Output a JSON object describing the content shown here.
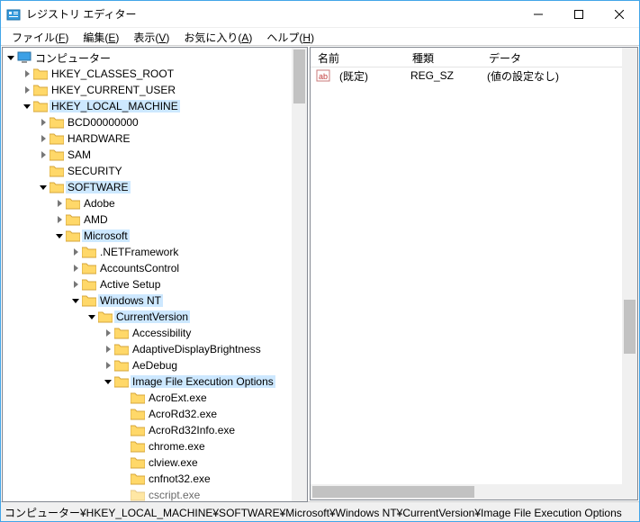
{
  "window": {
    "title": "レジストリ エディター"
  },
  "menu": {
    "file": "ファイル(F)",
    "edit": "編集(E)",
    "view": "表示(V)",
    "favorites": "お気に入り(A)",
    "help": "ヘルプ(H)"
  },
  "tree": {
    "root": "コンピューター",
    "hcr": "HKEY_CLASSES_ROOT",
    "hcu": "HKEY_CURRENT_USER",
    "hlm": "HKEY_LOCAL_MACHINE",
    "bcd": "BCD00000000",
    "hardware": "HARDWARE",
    "sam": "SAM",
    "security": "SECURITY",
    "software": "SOFTWARE",
    "adobe": "Adobe",
    "amd": "AMD",
    "microsoft": "Microsoft",
    "netfw": ".NETFramework",
    "accounts": "AccountsControl",
    "active": "Active Setup",
    "winnt": "Windows NT",
    "curver": "CurrentVersion",
    "access": "Accessibility",
    "adaptive": "AdaptiveDisplayBrightness",
    "aedebug": "AeDebug",
    "ifeo": "Image File Execution Options",
    "acroext": "AcroExt.exe",
    "acrord32": "AcroRd32.exe",
    "acrord32info": "AcroRd32Info.exe",
    "chrome": "chrome.exe",
    "clview": "clview.exe",
    "cnfnot32": "cnfnot32.exe",
    "cscript": "cscript.exe"
  },
  "list": {
    "col_name": "名前",
    "col_type": "種類",
    "col_data": "データ",
    "row0": {
      "name": "(既定)",
      "type": "REG_SZ",
      "data": "(値の設定なし)"
    }
  },
  "status": "コンピューター¥HKEY_LOCAL_MACHINE¥SOFTWARE¥Microsoft¥Windows NT¥CurrentVersion¥Image File Execution Options"
}
